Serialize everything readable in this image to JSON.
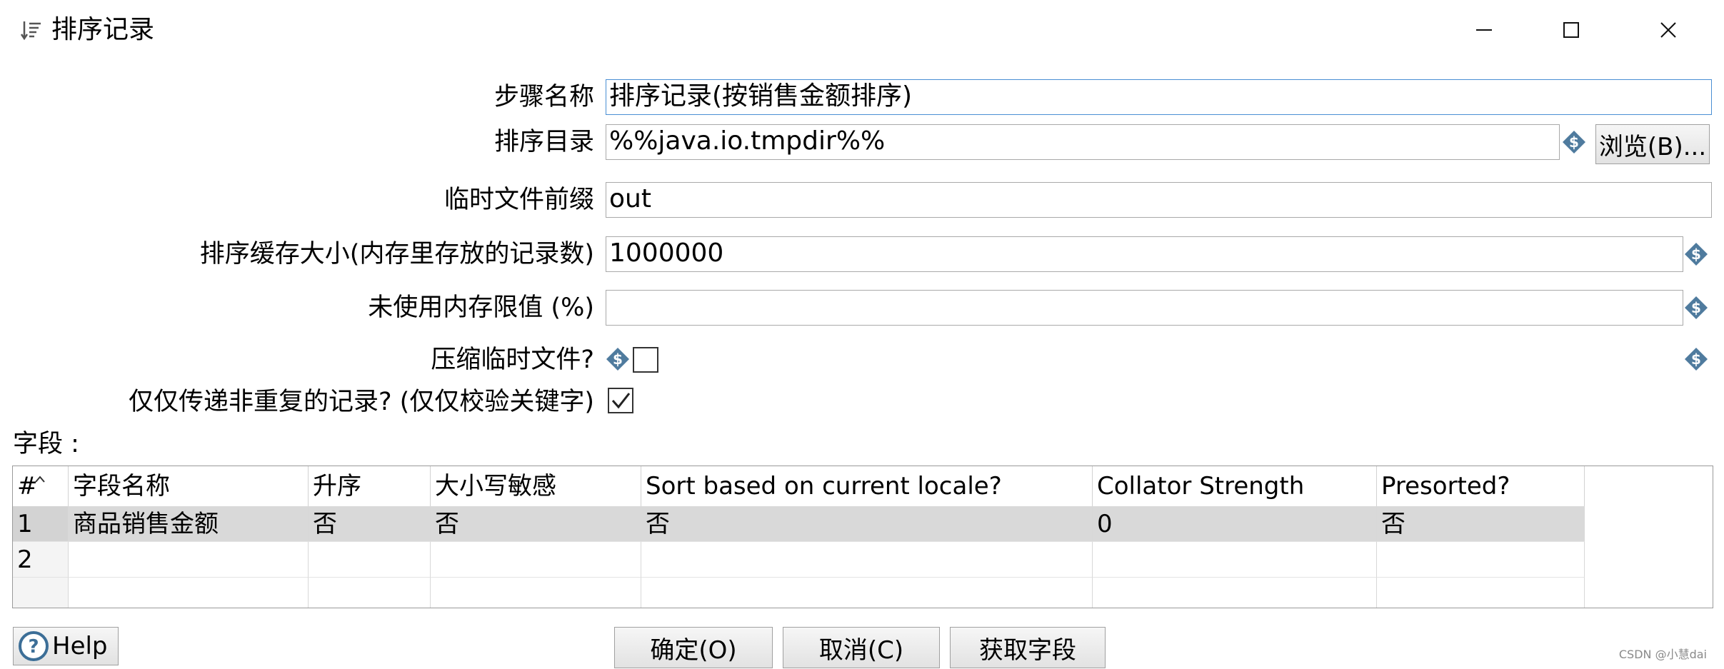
{
  "window": {
    "title": "排序记录",
    "icon": "sort-icon",
    "controls": [
      "minimize-icon",
      "maximize-icon",
      "close-icon"
    ]
  },
  "form": {
    "step_name": {
      "label": "步骤名称",
      "value": "排序记录(按销售金额排序)"
    },
    "sort_dir": {
      "label": "排序目录",
      "value": "%%java.io.tmpdir%%",
      "browse_label": "浏览(B)..."
    },
    "temp_prefix": {
      "label": "临时文件前缀",
      "value": "out"
    },
    "sort_size": {
      "label": "排序缓存大小(内存里存放的记录数)",
      "value": "1000000"
    },
    "free_memory": {
      "label": "未使用内存限值 (%)",
      "value": ""
    },
    "compress": {
      "label": "压缩临时文件?",
      "checked": false
    },
    "unique_rows": {
      "label": "仅仅传递非重复的记录? (仅仅校验关键字)",
      "checked": true
    }
  },
  "fields": {
    "label": "字段 :",
    "columns": [
      "#",
      "字段名称",
      "升序",
      "大小写敏感",
      "Sort based on current locale?",
      "Collator Strength",
      "Presorted?"
    ],
    "rows": [
      [
        "1",
        "商品销售金额",
        "否",
        "否",
        "否",
        "0",
        "否"
      ],
      [
        "2",
        "",
        "",
        "",
        "",
        "",
        ""
      ]
    ]
  },
  "buttons": {
    "help": "Help",
    "ok": "确定(O)",
    "cancel": "取消(C)",
    "get_fields": "获取字段"
  },
  "watermark": "CSDN @小慧dai"
}
